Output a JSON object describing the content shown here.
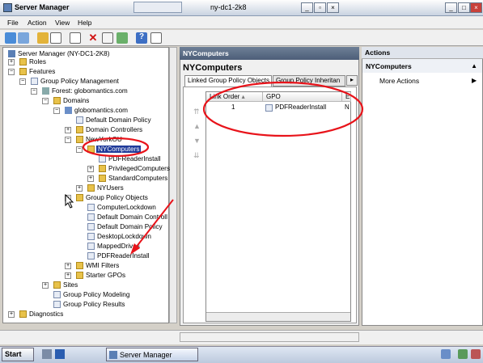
{
  "window": {
    "title": "Server Manager",
    "rdp_title": "ny-dc1-2k8"
  },
  "menu": [
    "File",
    "Action",
    "View",
    "Help"
  ],
  "tree": {
    "root": "Server Manager (NY-DC1-2K8)",
    "items": [
      {
        "label": "Roles"
      },
      {
        "label": "Features"
      },
      {
        "label": "Group Policy Management"
      },
      {
        "label": "Forest: globomantics.com"
      },
      {
        "label": "Domains"
      },
      {
        "label": "globomantics.com"
      },
      {
        "label": "Default Domain Policy"
      },
      {
        "label": "Domain Controllers"
      },
      {
        "label": "NewYorkOU"
      },
      {
        "label": "NYComputers"
      },
      {
        "label": "PDFReaderInstall"
      },
      {
        "label": "PrivilegedComputers"
      },
      {
        "label": "StandardComputers"
      },
      {
        "label": "NYUsers"
      },
      {
        "label": "Group Policy Objects"
      },
      {
        "label": "ComputerLockdown"
      },
      {
        "label": "Default Domain Controll"
      },
      {
        "label": "Default Domain Policy"
      },
      {
        "label": "DesktopLockdown"
      },
      {
        "label": "MappedDrives"
      },
      {
        "label": "PDFReaderInstall"
      },
      {
        "label": "WMI Filters"
      },
      {
        "label": "Starter GPOs"
      },
      {
        "label": "Sites"
      },
      {
        "label": "Group Policy Modeling"
      },
      {
        "label": "Group Policy Results"
      },
      {
        "label": "Diagnostics"
      }
    ]
  },
  "center": {
    "header": "NYComputers",
    "title": "NYComputers",
    "tabs": [
      "Linked Group Policy Objects",
      "Group Policy Inheritan"
    ],
    "columns": [
      "Link Order",
      "GPO",
      "E"
    ],
    "rows": [
      {
        "order": "1",
        "gpo": "PDFReaderInstall",
        "e": "N"
      }
    ]
  },
  "actions": {
    "header": "Actions",
    "section": "NYComputers",
    "more": "More Actions"
  },
  "taskbar": {
    "start": "Start",
    "task": "Server Manager",
    "clock": ""
  },
  "colors": {
    "highlight": "#1f3a9a",
    "annotation": "#e8131a"
  }
}
